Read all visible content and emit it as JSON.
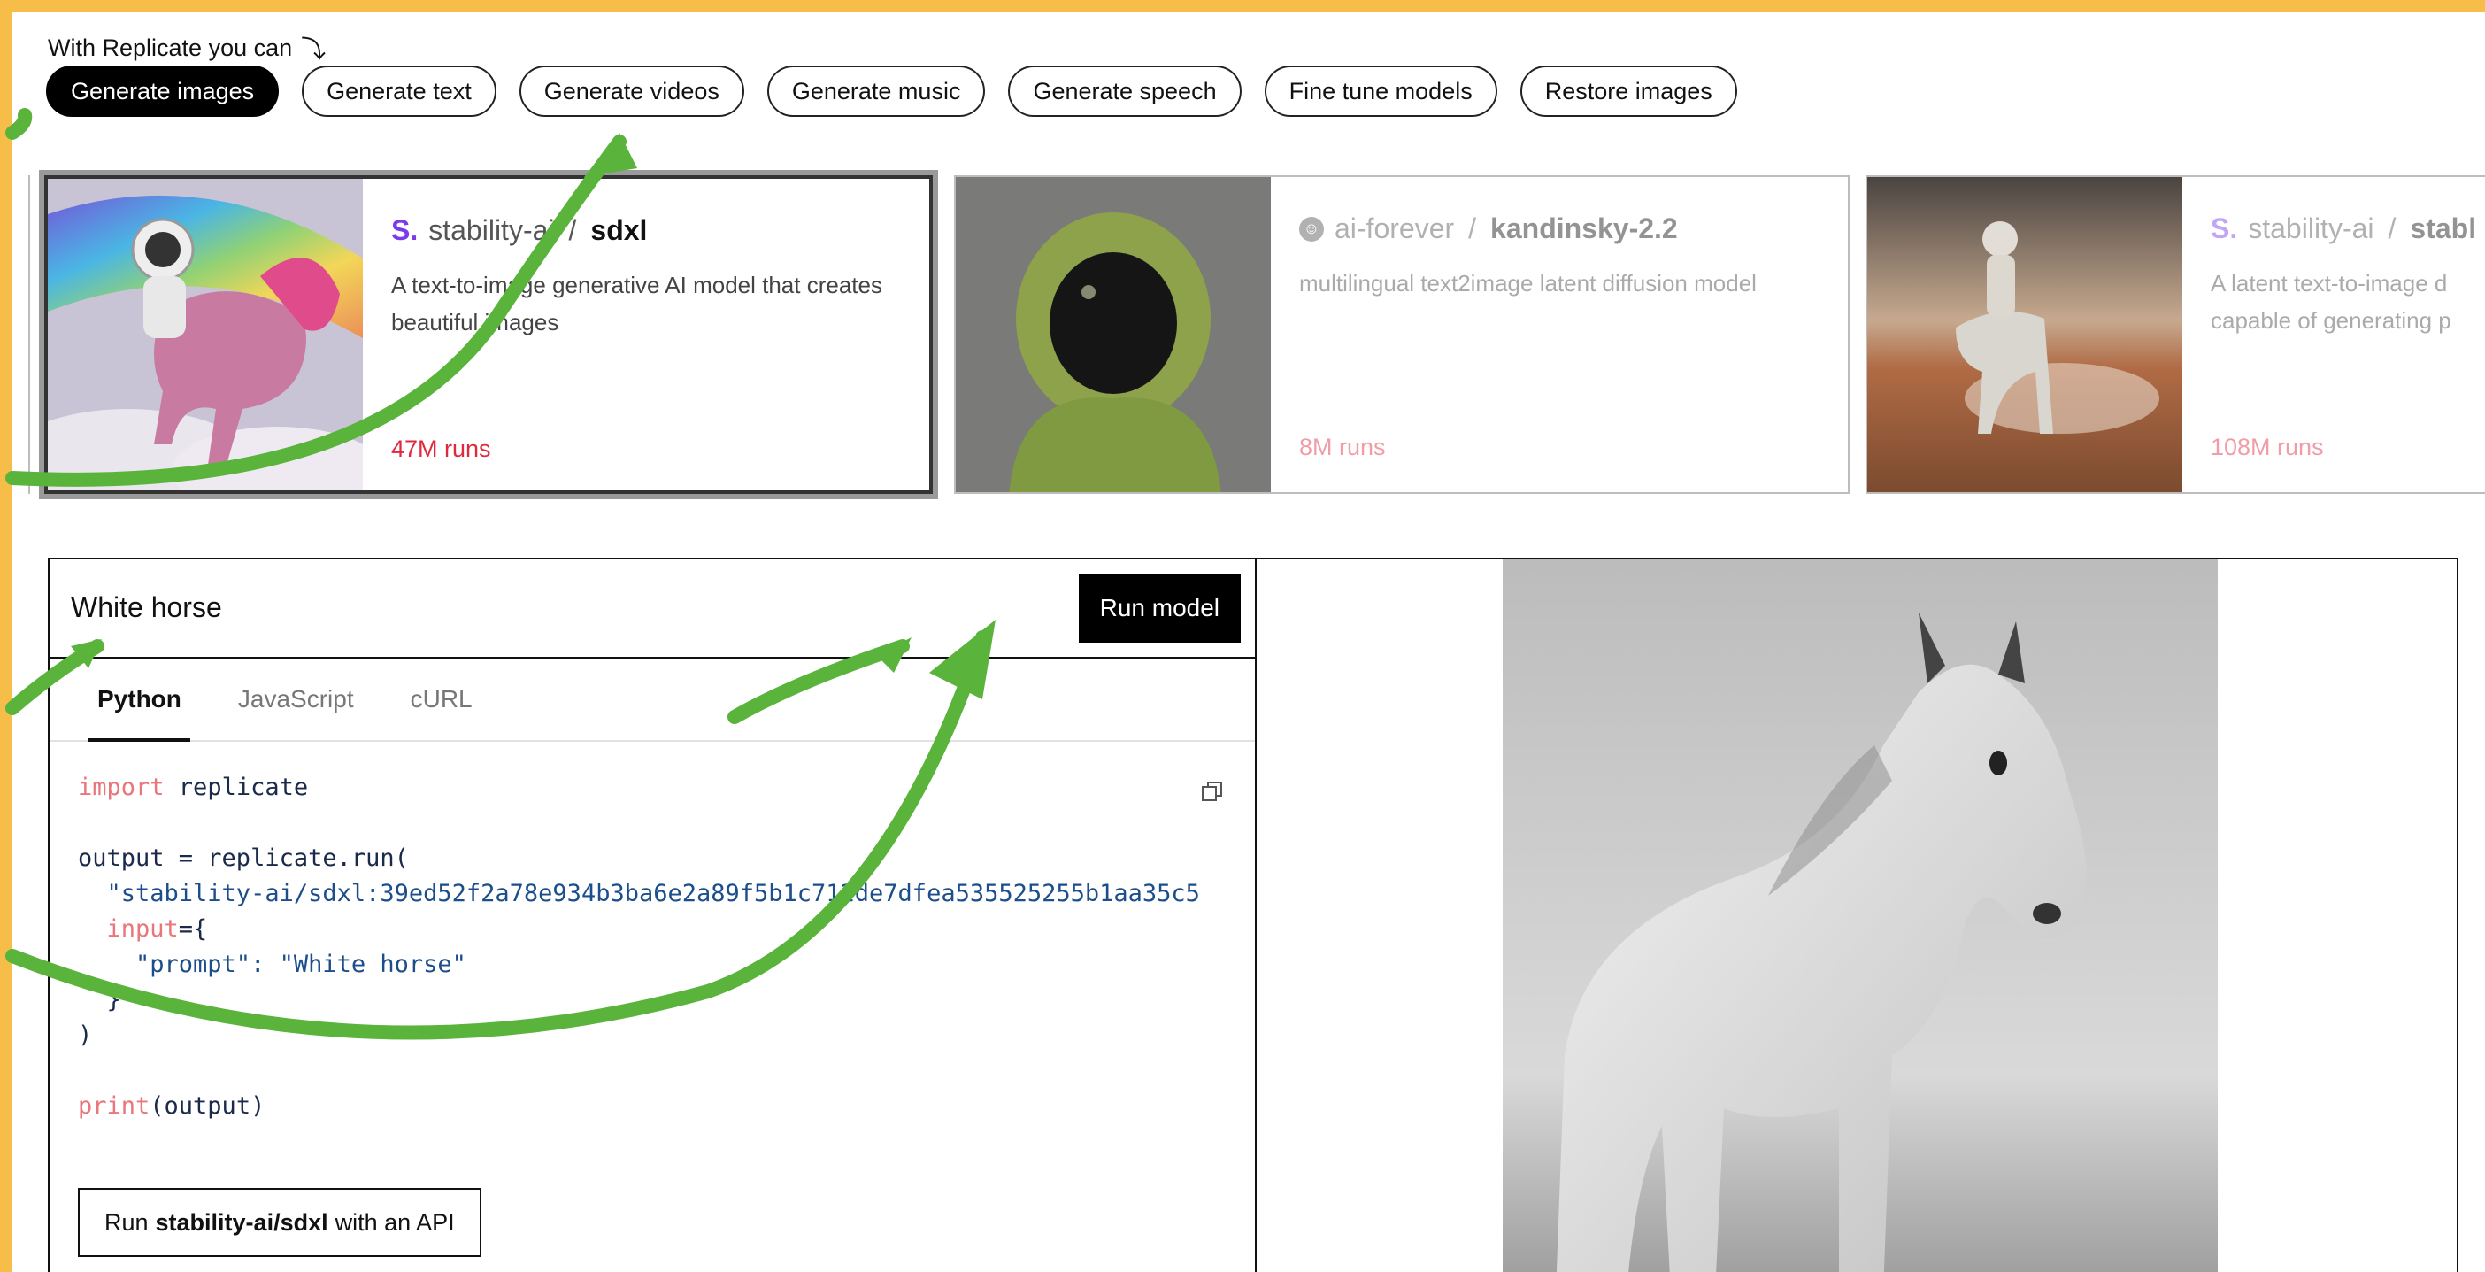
{
  "intro": {
    "label": "With Replicate you can",
    "arrow": "⤵"
  },
  "pills": [
    {
      "label": "Generate images",
      "active": true
    },
    {
      "label": "Generate text"
    },
    {
      "label": "Generate videos"
    },
    {
      "label": "Generate music"
    },
    {
      "label": "Generate speech"
    },
    {
      "label": "Fine tune models"
    },
    {
      "label": "Restore images"
    }
  ],
  "cards": [
    {
      "owner": "stability-ai",
      "separator": "/",
      "model": "sdxl",
      "description": "A text-to-image generative AI model that creates beautiful images",
      "runs": "47M runs",
      "logo": "S."
    },
    {
      "owner": "ai-forever",
      "separator": "/",
      "model": "kandinsky-2.2",
      "description": "multilingual text2image latent diffusion model",
      "runs": "8M runs",
      "logo": "☺"
    },
    {
      "owner": "stability-ai",
      "separator": "/",
      "model": "stabl",
      "description": "A latent text-to-image d capable of generating p",
      "runs": "108M runs",
      "logo": "S."
    }
  ],
  "panel": {
    "prompt": "White horse",
    "run_button": "Run model",
    "tabs": [
      "Python",
      "JavaScript",
      "cURL"
    ],
    "code": {
      "line1_kw": "import",
      "line1_rest": " replicate",
      "line3": "output = replicate.run(",
      "line4": "  \"stability-ai/sdxl:39ed52f2a78e934b3ba6e2a89f5b1c712de7dfea535525255b1aa35c5",
      "line5_kw": "  input",
      "line5_rest": "={",
      "line6": "    \"prompt\": \"White horse\"",
      "line7": "  }",
      "line8": ")",
      "line10_kw": "print",
      "line10_rest": "(output)"
    },
    "api_button": {
      "prefix": "Run",
      "model": "stability-ai/sdxl",
      "suffix": "with an API"
    }
  },
  "colors": {
    "background": "#f7bd49",
    "arrow": "#5ab43c",
    "runs": "#e0283e",
    "stability_logo": "#7c3aed"
  }
}
